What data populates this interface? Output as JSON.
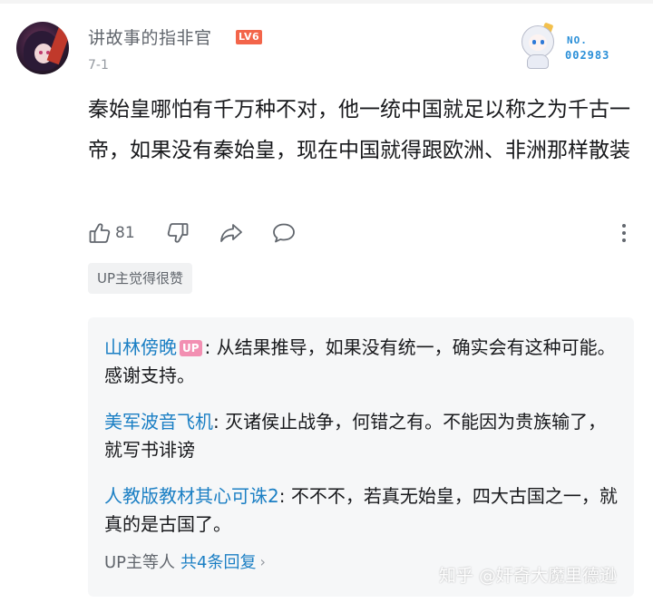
{
  "comment": {
    "username": "讲故事的指非官",
    "level": "LV6",
    "date": "7-1",
    "fan_badge": {
      "no_label": "NO.",
      "number": "002983"
    },
    "text": "秦始皇哪怕有千万种不对，他一统中国就足以称之为千古一帝，如果没有秦始皇，现在中国就得跟欧洲、非洲那样散装",
    "like_count": "81",
    "up_liked_label": "UP主觉得很赞"
  },
  "replies": [
    {
      "author": "山林傍晚",
      "up_tag": "UP",
      "text": ": 从结果推导，如果没有统一，确实会有这种可能。感谢支持。"
    },
    {
      "author": "美军波音飞机",
      "text": ": 灭诸侯止战争，何错之有。不能因为贵族输了，就写书诽谤"
    },
    {
      "author": "人教版教材其心可诛2",
      "text": ": 不不不，若真无始皇，四大古国之一，就真的是古国了。"
    }
  ],
  "replies_summary": {
    "prefix": "UP主等人",
    "more": "共4条回复"
  },
  "watermark": "知乎 @奸奇大魔里德逊",
  "colors": {
    "link_blue": "#1b7fc4",
    "level_red": "#f3654a",
    "up_pink": "#f28fb2"
  }
}
